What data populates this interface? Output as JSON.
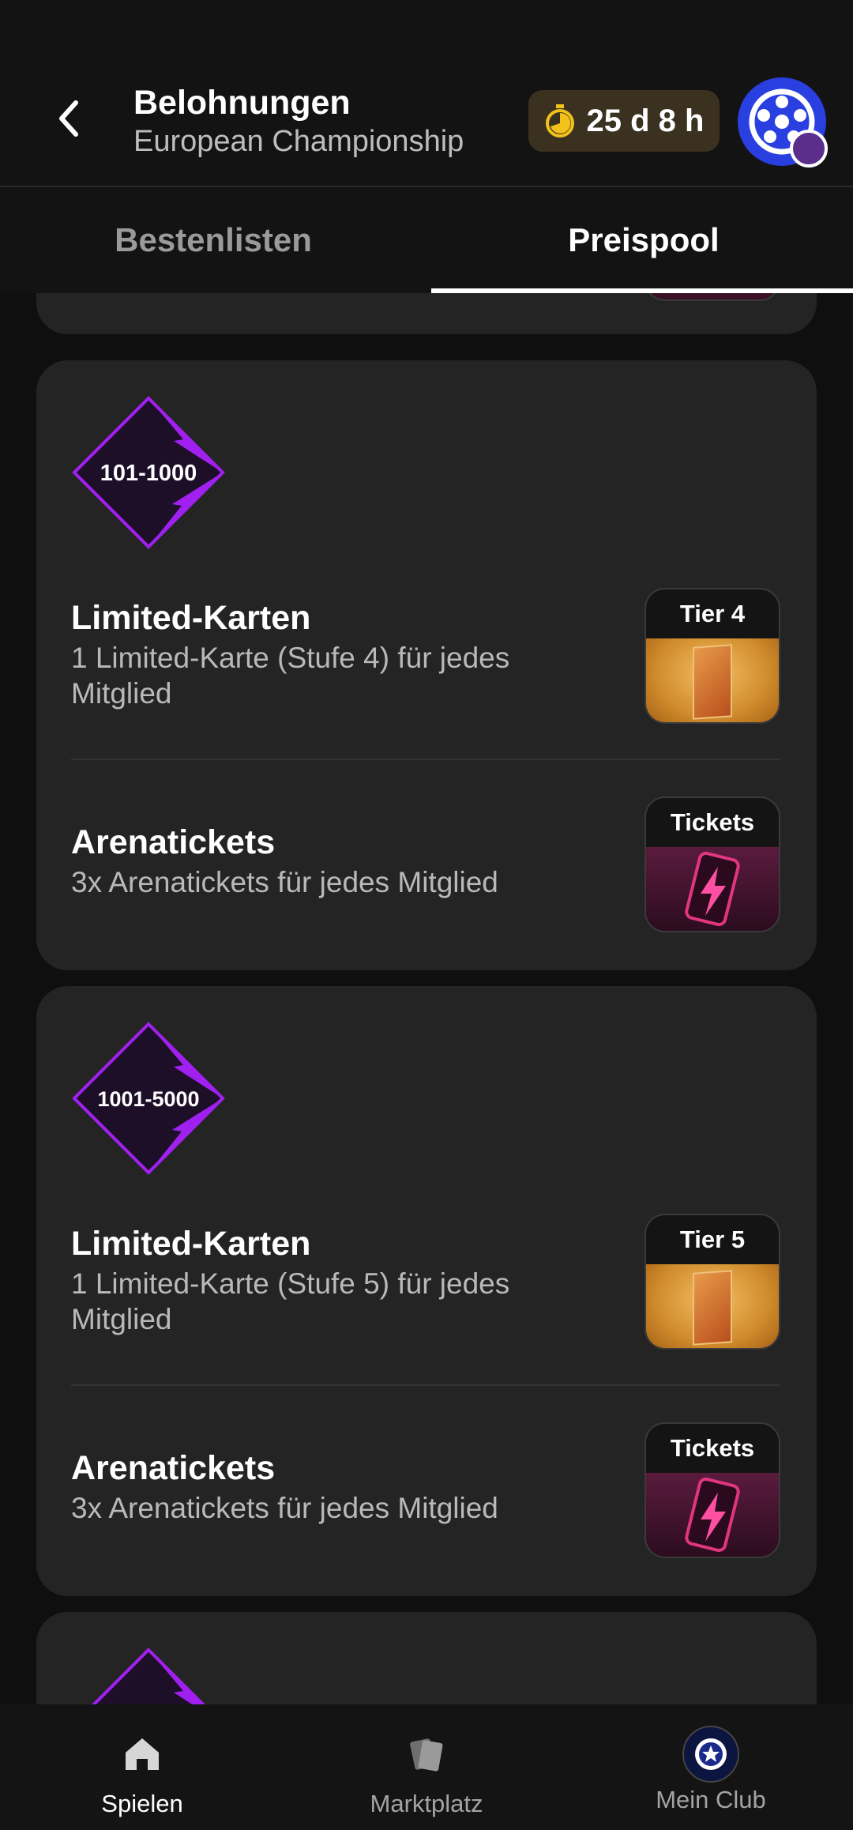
{
  "header": {
    "title": "Belohnungen",
    "subtitle": "European Championship",
    "timer": "25 d 8 h"
  },
  "tabs": [
    {
      "label": "Bestenlisten",
      "active": false
    },
    {
      "label": "Preispool",
      "active": true
    }
  ],
  "tiers": [
    {
      "rank": "101-1000",
      "rewards": [
        {
          "title": "Limited-Karten",
          "description": "1 Limited-Karte (Stufe 4) für jedes Mitglied",
          "badge": "Tier 4",
          "kind": "card"
        },
        {
          "title": "Arenatickets",
          "description": "3x Arenatickets für jedes Mitglied",
          "badge": "Tickets",
          "kind": "ticket"
        }
      ]
    },
    {
      "rank": "1001-5000",
      "rewards": [
        {
          "title": "Limited-Karten",
          "description": "1 Limited-Karte (Stufe 5) für jedes Mitglied",
          "badge": "Tier 5",
          "kind": "card"
        },
        {
          "title": "Arenatickets",
          "description": "3x Arenatickets für jedes Mitglied",
          "badge": "Tickets",
          "kind": "ticket"
        }
      ]
    }
  ],
  "bottom_nav": [
    {
      "label": "Spielen",
      "icon": "home-icon",
      "active": true
    },
    {
      "label": "Marktplatz",
      "icon": "cards-icon",
      "active": false
    },
    {
      "label": "Mein Club",
      "icon": "club-crest-icon",
      "active": false
    }
  ],
  "colors": {
    "background": "#0f0f10",
    "card": "#242424",
    "accent_purple": "#a020f0",
    "timer_bg": "#3a3120"
  }
}
